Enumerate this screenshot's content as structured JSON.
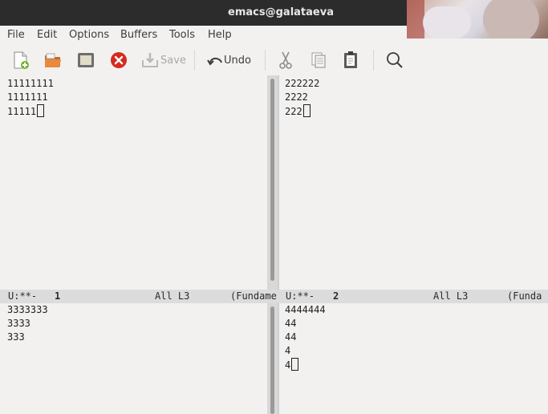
{
  "window": {
    "title": "emacs@galataeva"
  },
  "menu": [
    "File",
    "Edit",
    "Options",
    "Buffers",
    "Tools",
    "Help"
  ],
  "toolbar": {
    "new_file_icon": "new-file-icon",
    "open_icon": "open-folder-icon",
    "dired_icon": "directory-icon",
    "close_icon": "close-buffer-icon",
    "save_label": "Save",
    "undo_label": "Undo",
    "cut_icon": "scissors-icon",
    "copy_icon": "copy-icon",
    "paste_icon": "paste-icon",
    "search_icon": "search-icon"
  },
  "panes": {
    "top_left": {
      "lines": [
        "11111111",
        "1111111",
        "11111"
      ]
    },
    "top_right": {
      "lines": [
        "222222",
        "2222",
        "222"
      ]
    },
    "bottom_left": {
      "lines": [
        "3333333",
        "3333",
        "333"
      ]
    },
    "bottom_right": {
      "lines": [
        "4444444",
        "44",
        "44",
        "4",
        "4"
      ]
    }
  },
  "modelines": {
    "left": {
      "status": "U:**-",
      "buffer": "1",
      "position": "All L3",
      "mode": "(Fundame"
    },
    "right": {
      "status": "U:**-",
      "buffer": "2",
      "position": "All L3",
      "mode": "(Funda"
    }
  },
  "colors": {
    "titlebar": "#2c2c2c",
    "close_red": "#d52b1e",
    "background": "#f2f1f0",
    "modeline": "#dcdcdc"
  }
}
